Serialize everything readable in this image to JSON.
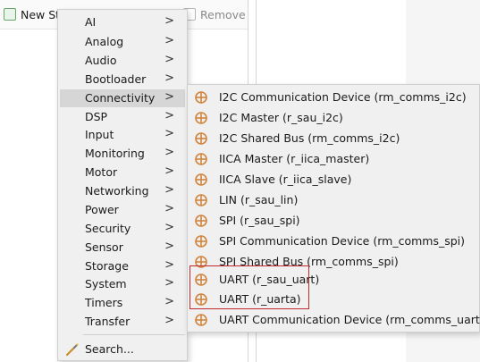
{
  "toolbar": {
    "new_label": "New St",
    "dimmed_label": "",
    "remove_label": "Remove"
  },
  "menu": {
    "items": [
      {
        "label": "AI"
      },
      {
        "label": "Analog"
      },
      {
        "label": "Audio"
      },
      {
        "label": "Bootloader"
      },
      {
        "label": "Connectivity"
      },
      {
        "label": "DSP"
      },
      {
        "label": "Input"
      },
      {
        "label": "Monitoring"
      },
      {
        "label": "Motor"
      },
      {
        "label": "Networking"
      },
      {
        "label": "Power"
      },
      {
        "label": "Security"
      },
      {
        "label": "Sensor"
      },
      {
        "label": "Storage"
      },
      {
        "label": "System"
      },
      {
        "label": "Timers"
      },
      {
        "label": "Transfer"
      }
    ],
    "active_item": "Connectivity",
    "chevron": ">",
    "search_label": "Search..."
  },
  "submenu": {
    "items": [
      {
        "label": "I2C Communication Device (rm_comms_i2c)"
      },
      {
        "label": "I2C Master (r_sau_i2c)"
      },
      {
        "label": "I2C Shared Bus (rm_comms_i2c)"
      },
      {
        "label": "IICA Master (r_iica_master)"
      },
      {
        "label": "IICA Slave (r_iica_slave)"
      },
      {
        "label": "LIN (r_sau_lin)"
      },
      {
        "label": "SPI (r_sau_spi)"
      },
      {
        "label": "SPI Communication Device (rm_comms_spi)"
      },
      {
        "label": "SPI Shared Bus (rm_comms_spi)"
      },
      {
        "label": "UART (r_sau_uart)"
      },
      {
        "label": "UART (r_uarta)"
      },
      {
        "label": "UART Communication Device (rm_comms_uart)"
      }
    ],
    "highlighted": [
      "UART (r_sau_uart)",
      "UART (r_uarta)"
    ]
  },
  "colors": {
    "menu_bg": "#f0f0f0",
    "active_bg": "#d6d6d6",
    "highlight_border": "#c0292b",
    "component_icon": "#d1843c"
  },
  "icons": {
    "component": "component-icon",
    "search": "search-wand-icon",
    "new": "new-stack-icon",
    "remove": "remove-icon"
  }
}
